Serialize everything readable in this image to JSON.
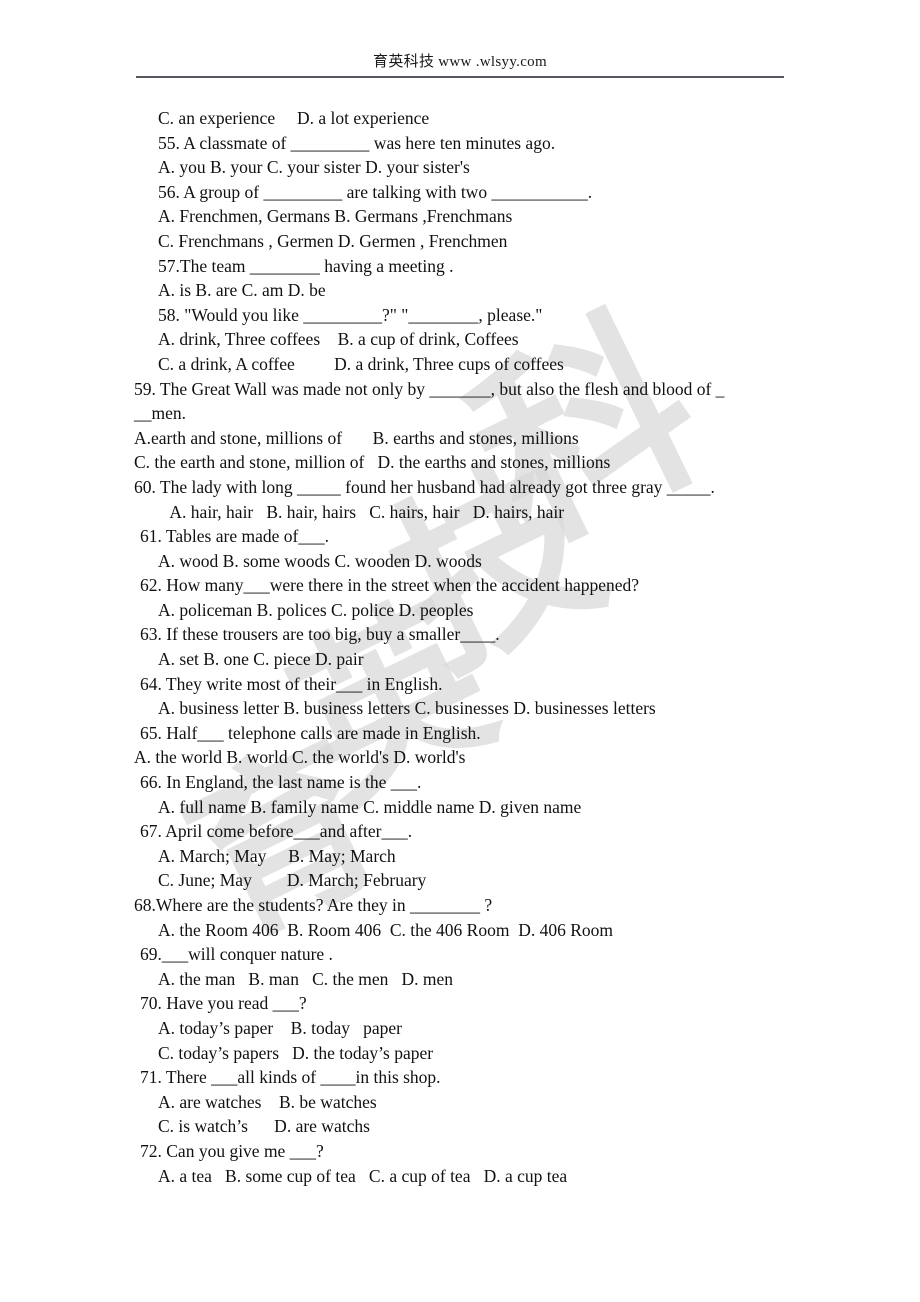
{
  "header": {
    "text": "育英科技 www .wlsyy.com"
  },
  "watermark": {
    "chars": [
      "科",
      "技",
      "英",
      "育"
    ],
    "color": "#d9d9d9"
  },
  "document": {
    "lines": [
      {
        "indent": 2,
        "text": "C. an experience     D. a lot experience"
      },
      {
        "indent": 2,
        "text": "55. A classmate of _________ was here ten minutes ago."
      },
      {
        "indent": 2,
        "text": "A. you B. your C. your sister D. your sister's"
      },
      {
        "indent": 2,
        "text": "56. A group of _________ are talking with two ___________."
      },
      {
        "indent": 2,
        "text": "A. Frenchmen, Germans B. Germans ,Frenchmans"
      },
      {
        "indent": 2,
        "text": "C. Frenchmans , Germen D. Germen , Frenchmen"
      },
      {
        "indent": 2,
        "text": "57.The team ________ having a meeting ."
      },
      {
        "indent": 2,
        "text": "A. is B. are C. am D. be"
      },
      {
        "indent": 2,
        "text": "58. \"Would you like _________?\" \"________, please.\""
      },
      {
        "indent": 2,
        "text": "A. drink, Three coffees    B. a cup of drink, Coffees"
      },
      {
        "indent": 2,
        "text": "C. a drink, A coffee         D. a drink, Three cups of coffees"
      },
      {
        "indent": 0,
        "text": "59. The Great Wall was made not only by _______, but also the flesh and blood of _"
      },
      {
        "indent": 0,
        "text": "__men."
      },
      {
        "indent": 0,
        "text": "A.earth and stone, millions of       B. earths and stones, millions"
      },
      {
        "indent": 0,
        "text": "C. the earth and stone, million of   D. the earths and stones, millions"
      },
      {
        "indent": 0,
        "text": "60. The lady with long _____ found her husband had already got three gray _____."
      },
      {
        "indent": 3,
        "text": " A. hair, hair   B. hair, hairs   C. hairs, hair   D. hairs, hair"
      },
      {
        "indent": 1,
        "text": "61. Tables are made of___."
      },
      {
        "indent": 2,
        "text": "A. wood B. some woods C. wooden D. woods"
      },
      {
        "indent": 1,
        "text": "62. How many___were there in the street when the accident happened?"
      },
      {
        "indent": 2,
        "text": "A. policeman B. polices C. police D. peoples"
      },
      {
        "indent": 1,
        "text": "63. If these trousers are too big, buy a smaller____."
      },
      {
        "indent": 2,
        "text": "A. set B. one C. piece D. pair"
      },
      {
        "indent": 1,
        "text": "64. They write most of their___ in English."
      },
      {
        "indent": 2,
        "text": "A. business letter B. business letters C. businesses D. businesses letters"
      },
      {
        "indent": 1,
        "text": "65. Half___ telephone calls are made in English."
      },
      {
        "indent": 0,
        "text": "A. the world B. world C. the world's D. world's"
      },
      {
        "indent": 1,
        "text": "66. In England, the last name is the ___."
      },
      {
        "indent": 2,
        "text": "A. full name B. family name C. middle name D. given name"
      },
      {
        "indent": 1,
        "text": "67. April come before___and after___."
      },
      {
        "indent": 2,
        "text": "A. March; May     B. May; March"
      },
      {
        "indent": 2,
        "text": "C. June; May        D. March; February"
      },
      {
        "indent": 0,
        "text": "68.Where are the students? Are they in ________ ?"
      },
      {
        "indent": 2,
        "text": "A. the Room 406  B. Room 406  C. the 406 Room  D. 406 Room"
      },
      {
        "indent": 1,
        "text": "69.___will conquer nature ."
      },
      {
        "indent": 2,
        "text": "A. the man   B. man   C. the men   D. men"
      },
      {
        "indent": 1,
        "text": "70. Have you read ___?"
      },
      {
        "indent": 2,
        "text": "A. today’s paper    B. today   paper"
      },
      {
        "indent": 2,
        "text": "C. today’s papers   D. the today’s paper"
      },
      {
        "indent": 1,
        "text": "71. There ___all kinds of ____in this shop."
      },
      {
        "indent": 2,
        "text": "A. are watches    B. be watches"
      },
      {
        "indent": 2,
        "text": "C. is watch’s      D. are watchs"
      },
      {
        "indent": 1,
        "text": "72. Can you give me ___?"
      },
      {
        "indent": 2,
        "text": "A. a tea   B. some cup of tea   C. a cup of tea   D. a cup tea"
      }
    ]
  }
}
